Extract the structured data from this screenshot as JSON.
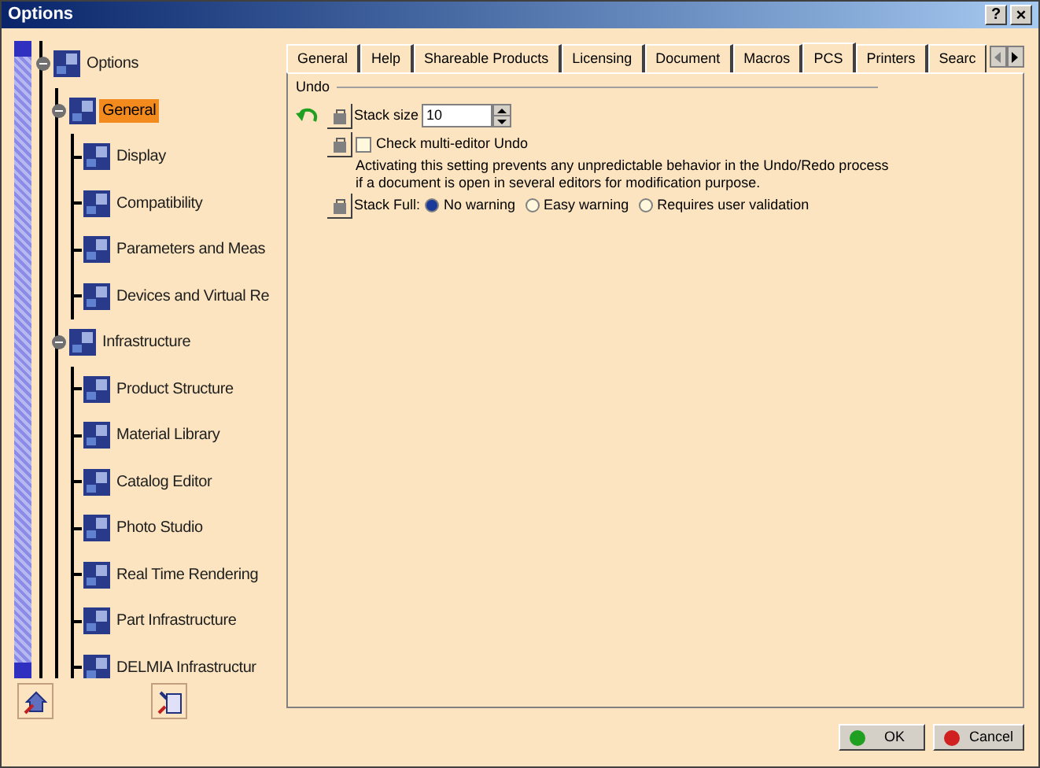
{
  "window": {
    "title": "Options",
    "help_button": "?",
    "close_button": "×"
  },
  "tree": {
    "label": "Options",
    "expanded": true,
    "selected": false,
    "children": [
      {
        "label": "General",
        "expanded": true,
        "selected": true,
        "children": [
          {
            "label": "Display",
            "selected": false
          },
          {
            "label": "Compatibility",
            "selected": false
          },
          {
            "label": "Parameters and Meas",
            "selected": false
          },
          {
            "label": "Devices and Virtual Re",
            "selected": false
          }
        ]
      },
      {
        "label": "Infrastructure",
        "expanded": true,
        "selected": false,
        "children": [
          {
            "label": "Product Structure",
            "selected": false
          },
          {
            "label": "Material Library",
            "selected": false
          },
          {
            "label": "Catalog Editor",
            "selected": false
          },
          {
            "label": "Photo Studio",
            "selected": false
          },
          {
            "label": "Real Time Rendering",
            "selected": false
          },
          {
            "label": "Part Infrastructure",
            "selected": false
          },
          {
            "label": "DELMIA Infrastructur",
            "selected": false
          }
        ]
      }
    ]
  },
  "tabs": [
    {
      "label": "General",
      "selected": false
    },
    {
      "label": "Help",
      "selected": false
    },
    {
      "label": "Shareable Products",
      "selected": false
    },
    {
      "label": "Licensing",
      "selected": false
    },
    {
      "label": "Document",
      "selected": false
    },
    {
      "label": "Macros",
      "selected": false
    },
    {
      "label": "PCS",
      "selected": true
    },
    {
      "label": "Printers",
      "selected": false
    },
    {
      "label": "Searc",
      "selected": false
    }
  ],
  "undo": {
    "title": "Undo",
    "stack_size": {
      "label": "Stack size",
      "value": "10"
    },
    "multi_editor": {
      "label": "Check multi-editor Undo",
      "checked": false
    },
    "description": [
      "Activating this setting prevents any unpredictable behavior in the Undo/Redo process",
      "if a document is open in several editors for modification purpose."
    ],
    "stack_full": {
      "label": "Stack Full:",
      "options": [
        {
          "label": "No warning",
          "selected": true
        },
        {
          "label": "Easy warning",
          "selected": false
        },
        {
          "label": "Requires user validation",
          "selected": false
        }
      ]
    }
  },
  "buttons": [
    {
      "label": "OK",
      "kind": "ok"
    },
    {
      "label": "Cancel",
      "kind": "cancel"
    }
  ]
}
